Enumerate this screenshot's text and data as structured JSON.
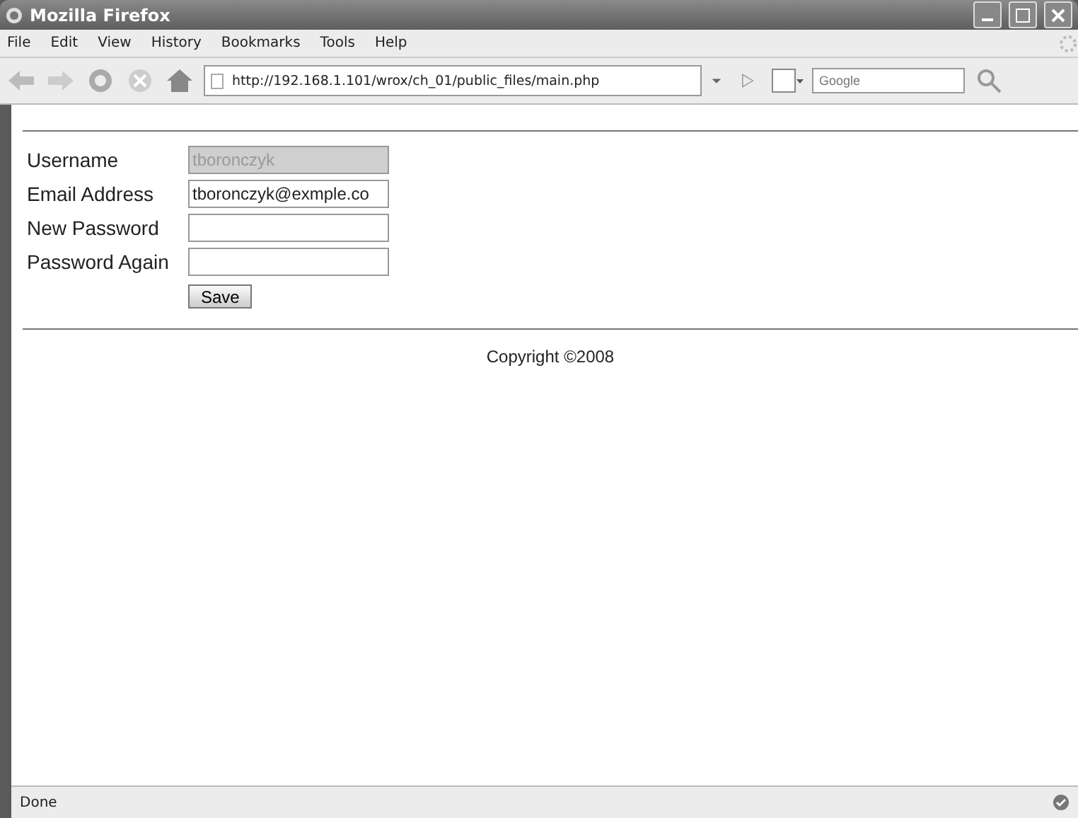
{
  "window": {
    "title": "Mozilla Firefox"
  },
  "menu": [
    "File",
    "Edit",
    "View",
    "History",
    "Bookmarks",
    "Tools",
    "Help"
  ],
  "address_bar": {
    "value": "http://192.168.1.101/wrox/ch_01/public_files/main.php"
  },
  "search": {
    "placeholder": "Google"
  },
  "form": {
    "fields": [
      {
        "label": "Username",
        "value": "tboronczyk",
        "disabled": true
      },
      {
        "label": "Email Address",
        "value": "tboronczyk@exmple.co",
        "disabled": false
      },
      {
        "label": "New Password",
        "disabled": false
      },
      {
        "label": "Password Again",
        "disabled": false
      }
    ],
    "button": "Save"
  },
  "footer": "Copyright ©2008",
  "status_bar": "Done"
}
